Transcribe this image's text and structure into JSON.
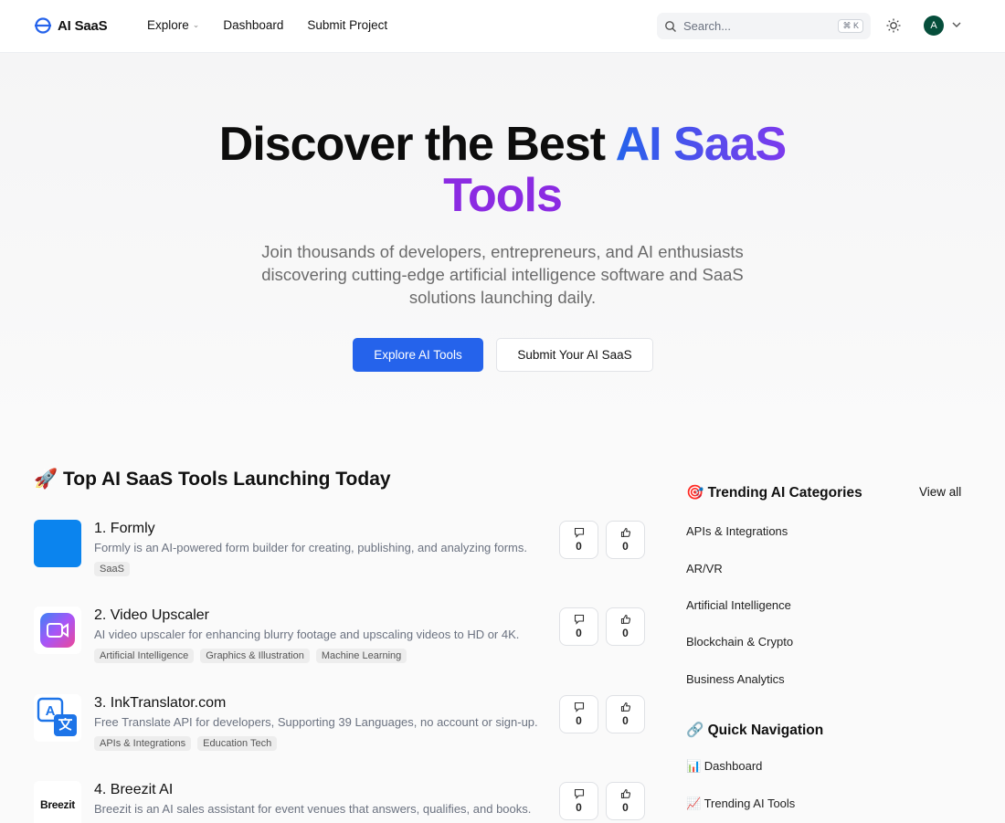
{
  "header": {
    "logo_text": "AI SaaS",
    "nav": [
      "Explore",
      "Dashboard",
      "Submit Project"
    ],
    "search_placeholder": "Search...",
    "shortcut": "⌘ K",
    "avatar_initial": "A"
  },
  "hero": {
    "title_line1_plain": "Discover the Best ",
    "title_line1_accent": "AI SaaS",
    "title_line2_accent": "Tools",
    "subtitle": "Join thousands of developers, entrepreneurs, and AI enthusiasts discovering cutting-edge artificial intelligence software and SaaS solutions launching daily.",
    "primary_button": "Explore AI Tools",
    "secondary_button": "Submit Your AI SaaS"
  },
  "launches": {
    "title": "🚀 Top AI SaaS Tools Launching Today",
    "items": [
      {
        "name": "1. Formly",
        "description": "Formly is an AI-powered form builder for creating, publishing, and analyzing forms.",
        "tags": [
          "SaaS"
        ],
        "comments": "0",
        "upvotes": "0",
        "thumb": "blue-square"
      },
      {
        "name": "2. Video Upscaler",
        "description": "AI video upscaler for enhancing blurry footage and upscaling videos to HD or 4K.",
        "tags": [
          "Artificial Intelligence",
          "Graphics & Illustration",
          "Machine Learning"
        ],
        "comments": "0",
        "upvotes": "0",
        "thumb": "video-camera"
      },
      {
        "name": "3. InkTranslator.com",
        "description": "Free Translate API for developers, Supporting 39 Languages, no account or sign-up.",
        "tags": [
          "APIs & Integrations",
          "Education Tech"
        ],
        "comments": "0",
        "upvotes": "0",
        "thumb": "translate"
      },
      {
        "name": "4. Breezit AI",
        "description": "Breezit is an AI sales assistant for event venues that answers, qualifies, and books.",
        "tags": [],
        "comments": "0",
        "upvotes": "0",
        "thumb": "Breezit"
      }
    ]
  },
  "sidebar": {
    "trending_title": "🎯 Trending AI Categories",
    "view_all": "View all",
    "categories": [
      "APIs & Integrations",
      "AR/VR",
      "Artificial Intelligence",
      "Blockchain & Crypto",
      "Business Analytics"
    ],
    "quick_nav_title": "🔗 Quick Navigation",
    "quick_nav": [
      "📊 Dashboard",
      "📈 Trending AI Tools"
    ]
  },
  "colors": {
    "primary": "#2563eb",
    "accent_purple": "#8b2be2",
    "avatar": "#064e3b"
  }
}
